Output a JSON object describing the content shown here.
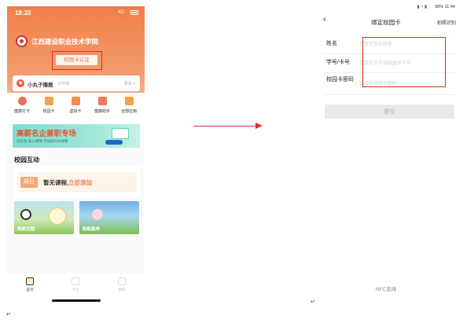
{
  "left_phone": {
    "status_time": "18:33",
    "status_network": "4G",
    "school_name": "江西建设职业技术学院",
    "campus_card_button": "校园卡认证",
    "notice": {
      "title": "小丸子播报",
      "subtitle": "12天前",
      "more": "更多 >"
    },
    "apps": [
      {
        "label": "健康打卡",
        "icon": "heart-icon",
        "color": "#f06a5b"
      },
      {
        "label": "校园卡",
        "icon": "card-icon",
        "color": "#f4a24b"
      },
      {
        "label": "虚拟卡",
        "icon": "virtual-card-icon",
        "color": "#f28d4c"
      },
      {
        "label": "健康助手",
        "icon": "health-assistant-icon",
        "color": "#f07b5a"
      },
      {
        "label": "全部应用",
        "icon": "grid-icon",
        "color": "#f5a146"
      }
    ],
    "banner": {
      "title": "高薪名企兼职专场",
      "subtitle": "包吃住 安心保障 不加班时长保障"
    },
    "section_title": "校园互动",
    "schedule": {
      "week_badge": "周日",
      "text": "暂无课程,",
      "link": "立即添加"
    },
    "tiles": [
      {
        "label": "蚂蚁庄园"
      },
      {
        "label": "蚂蚁森林"
      }
    ],
    "tabs": [
      {
        "label": "首页",
        "active": true
      },
      {
        "label": "卡包",
        "active": false
      },
      {
        "label": "我的",
        "active": false
      }
    ]
  },
  "right_phone": {
    "status_battery": "98%",
    "status_time": "11:44",
    "nav_back": "‹",
    "nav_title": "绑定校园卡",
    "nav_action": "拍照识别",
    "form": {
      "name_label": "姓名",
      "name_placeholder": "请填写真实姓名",
      "id_label": "学号/卡号",
      "id_placeholder": "请填写学号或校园卡卡号",
      "password_label": "校园卡密码",
      "password_placeholder": "请填写校园卡密码"
    },
    "submit_label": "提交",
    "nfc_label": "NFC支持"
  },
  "paragraph_mark": "↵"
}
